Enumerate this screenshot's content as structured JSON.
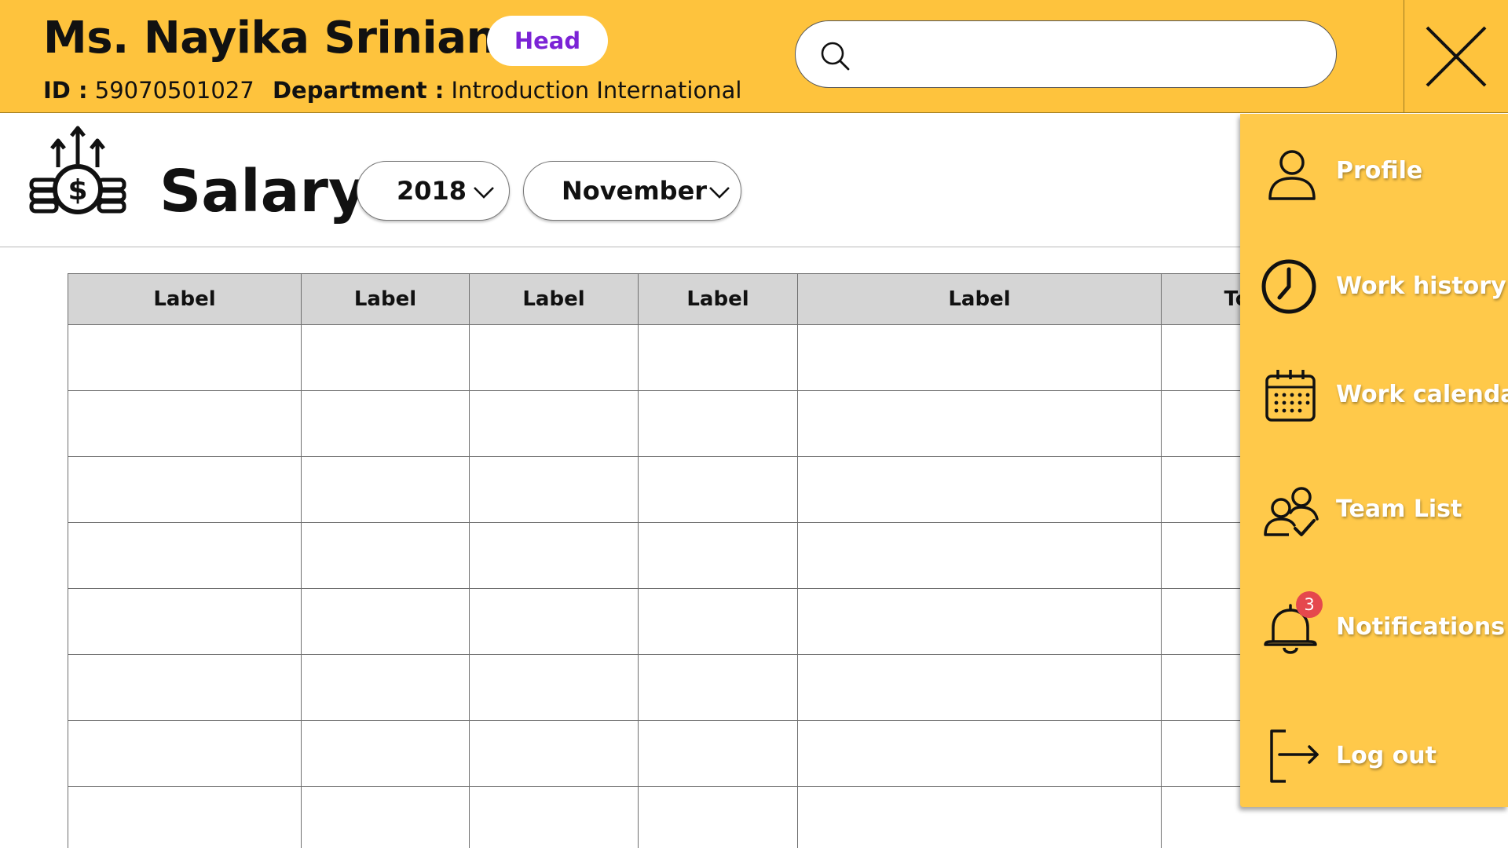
{
  "header": {
    "user_name": "Ms. Nayika Srinian",
    "role_badge": "Head",
    "id_label": "ID :",
    "id_value": "59070501027",
    "department_label": "Department :",
    "department_value": "Introduction International",
    "search_placeholder": "",
    "background_color": "#FEC33D",
    "badge_text_color": "#7B23D6"
  },
  "page": {
    "title": "Salary",
    "icon": "salary-growth-icon"
  },
  "filters": {
    "year": "2018",
    "month": "November"
  },
  "table": {
    "columns": [
      "Label",
      "Label",
      "Label",
      "Label",
      "Label",
      "Total"
    ],
    "rows": [
      [
        "",
        "",
        "",
        "",
        "",
        ""
      ],
      [
        "",
        "",
        "",
        "",
        "",
        ""
      ],
      [
        "",
        "",
        "",
        "",
        "",
        ""
      ],
      [
        "",
        "",
        "",
        "",
        "",
        ""
      ],
      [
        "",
        "",
        "",
        "",
        "",
        ""
      ],
      [
        "",
        "",
        "",
        "",
        "",
        ""
      ],
      [
        "",
        "",
        "",
        "",
        "",
        ""
      ],
      [
        "",
        "",
        "",
        "",
        "",
        ""
      ]
    ]
  },
  "side_menu": {
    "background_color": "#FFC94A",
    "items": [
      {
        "label": "Profile",
        "icon": "user-icon"
      },
      {
        "label": "Work history",
        "icon": "clock-icon"
      },
      {
        "label": "Work calendar",
        "icon": "calendar-icon"
      },
      {
        "label": "Team List",
        "icon": "team-check-icon"
      },
      {
        "label": "Notifications",
        "icon": "bell-icon",
        "badge": "3"
      },
      {
        "label": "Log out",
        "icon": "logout-icon"
      }
    ]
  }
}
